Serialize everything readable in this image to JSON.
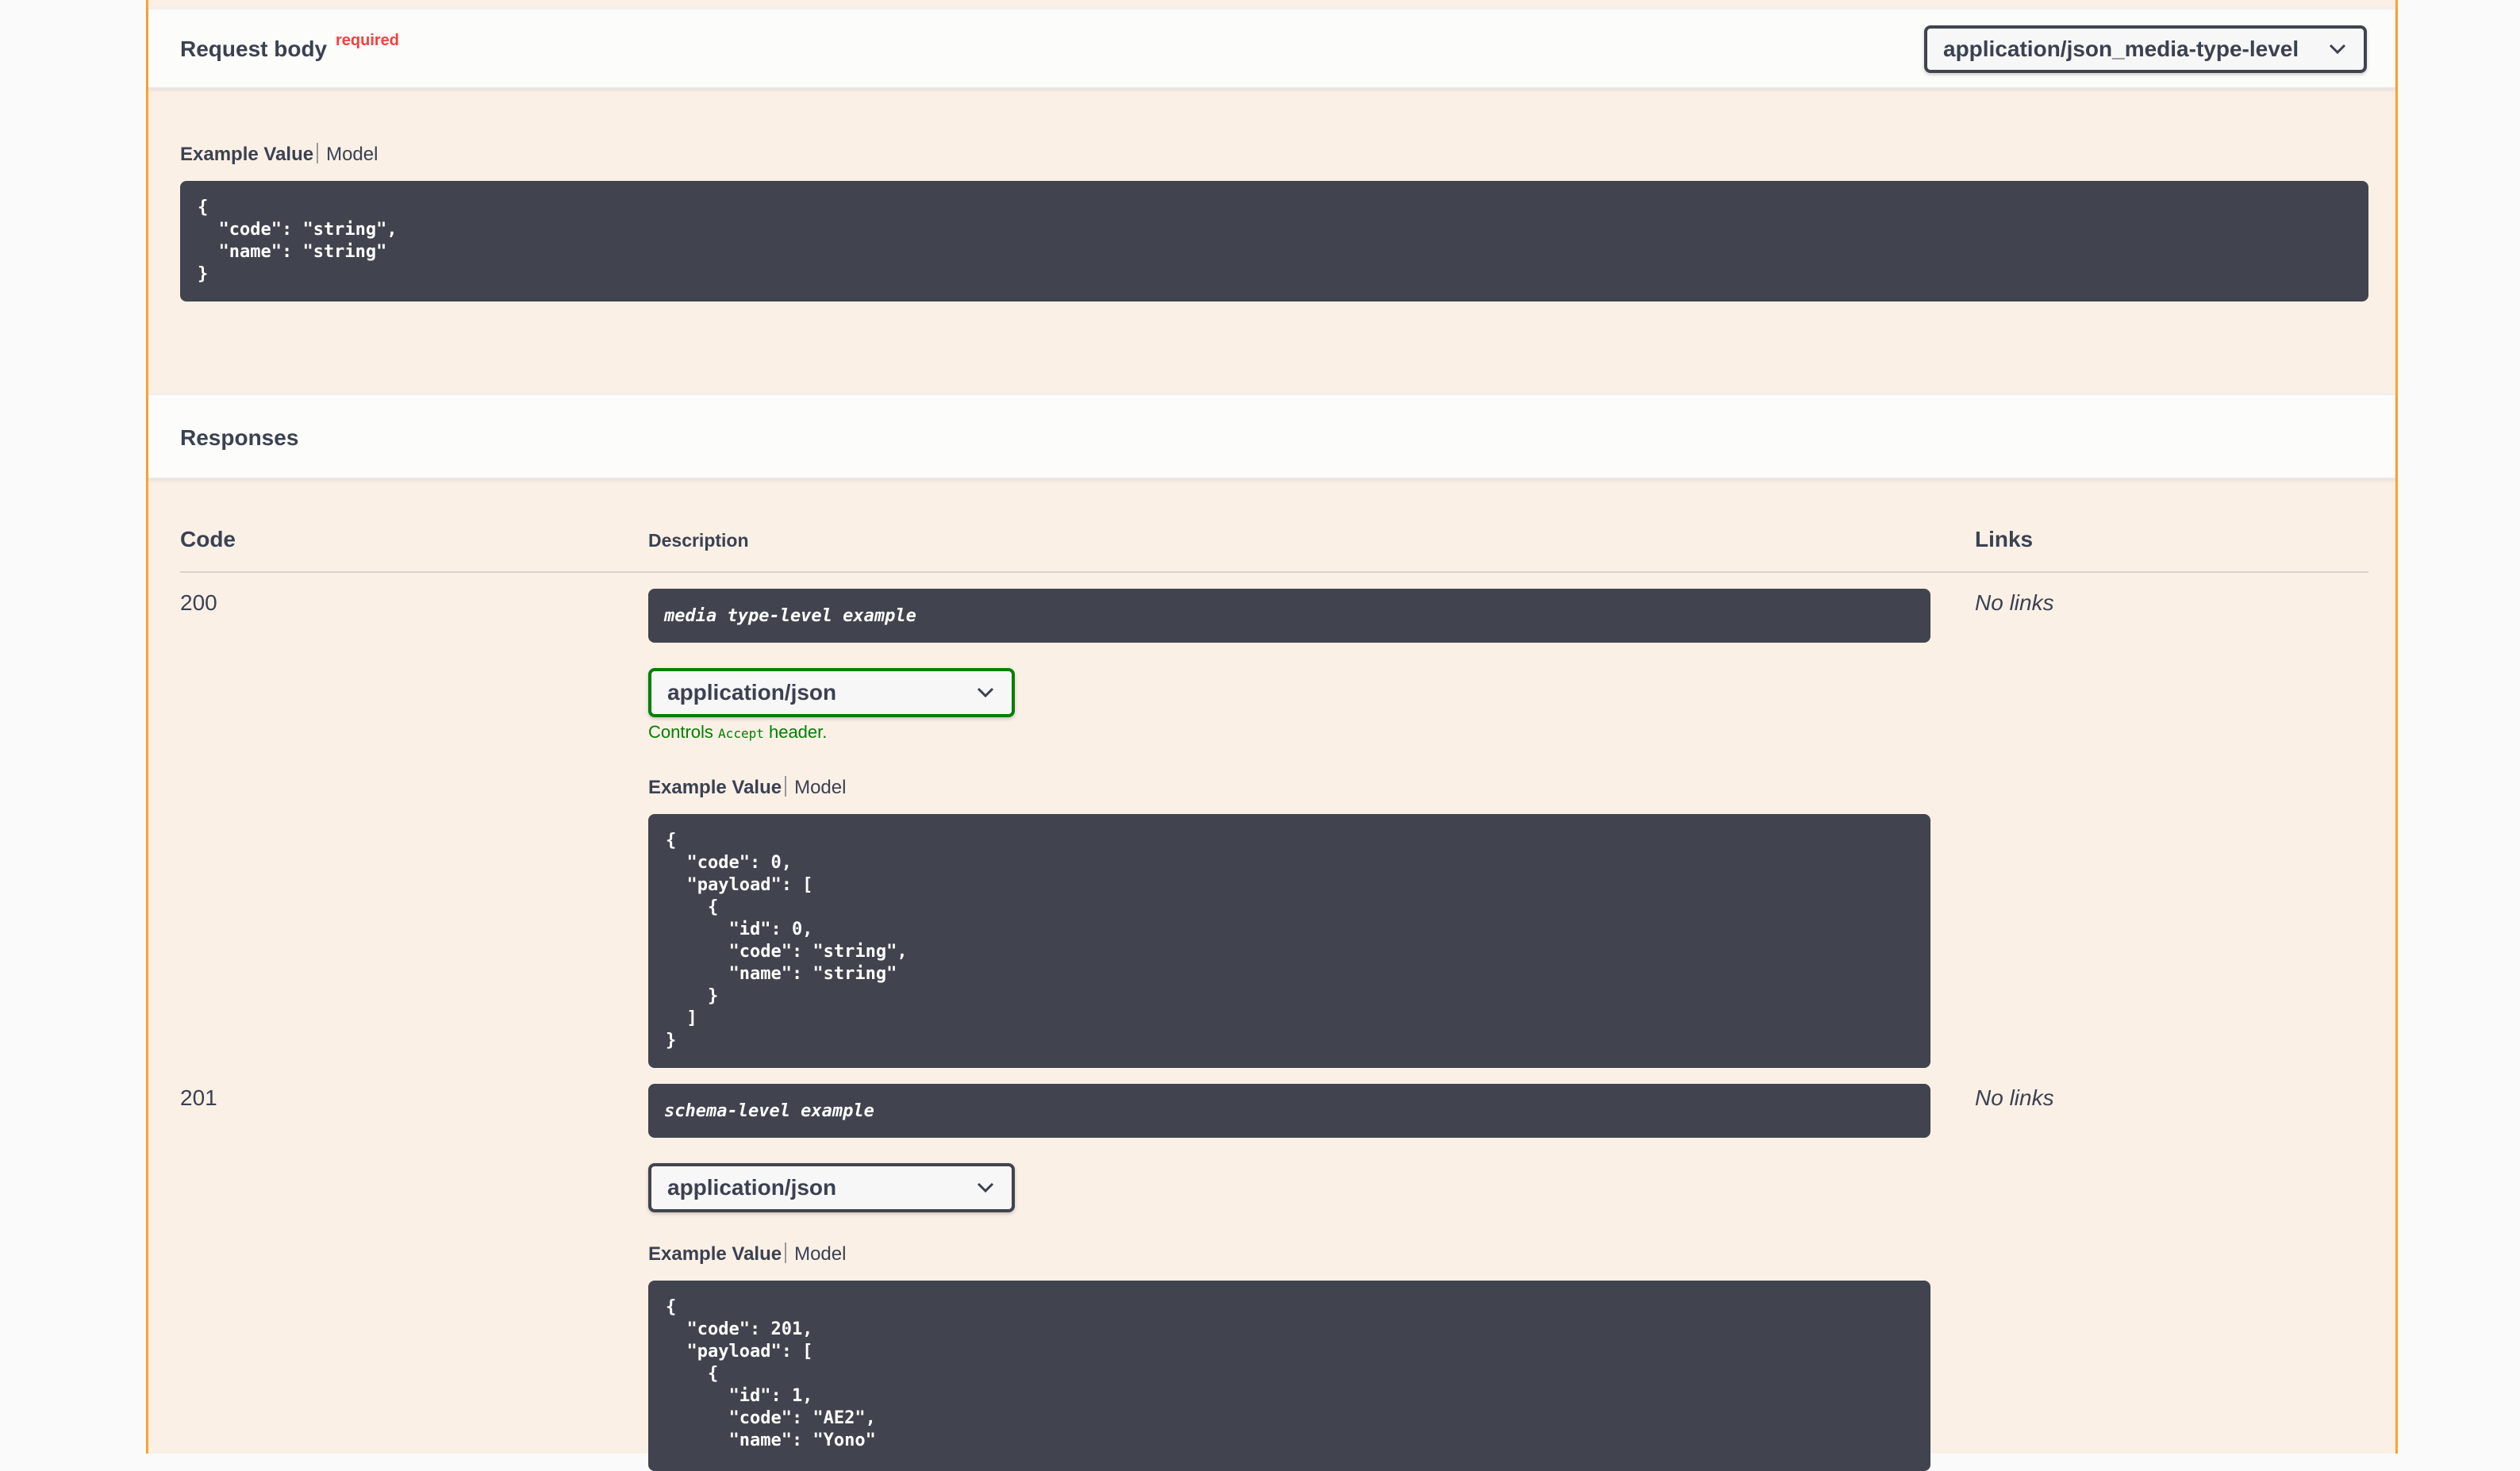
{
  "request_body": {
    "title": "Request body",
    "required_label": "required",
    "content_type_selected": "application/json_media-type-level",
    "tabs": {
      "example_value": "Example Value",
      "model": "Model"
    },
    "example": "{\n  \"code\": \"string\",\n  \"name\": \"string\"\n}"
  },
  "responses": {
    "title": "Responses",
    "columns": {
      "code": "Code",
      "description": "Description",
      "links": "Links"
    },
    "rows": [
      {
        "code": "200",
        "description": "media type-level example",
        "media_type": "application/json",
        "controls_prefix": "Controls",
        "controls_code": "Accept",
        "controls_suffix": "header.",
        "tabs": {
          "example_value": "Example Value",
          "model": "Model"
        },
        "example": "{\n  \"code\": 0,\n  \"payload\": [\n    {\n      \"id\": 0,\n      \"code\": \"string\",\n      \"name\": \"string\"\n    }\n  ]\n}",
        "links": "No links"
      },
      {
        "code": "201",
        "description": "schema-level example",
        "media_type": "application/json",
        "tabs": {
          "example_value": "Example Value",
          "model": "Model"
        },
        "example": "{\n  \"code\": 201,\n  \"payload\": [\n    {\n      \"id\": 1,\n      \"code\": \"AE2\",\n      \"name\": \"Yono\"",
        "links": "No links"
      }
    ]
  },
  "colors": {
    "post_accent": "#fca130",
    "opblock_bg": "#faf0e6",
    "code_bg": "#41444e",
    "required": "#f93e3e",
    "controls_green": "#008000"
  }
}
